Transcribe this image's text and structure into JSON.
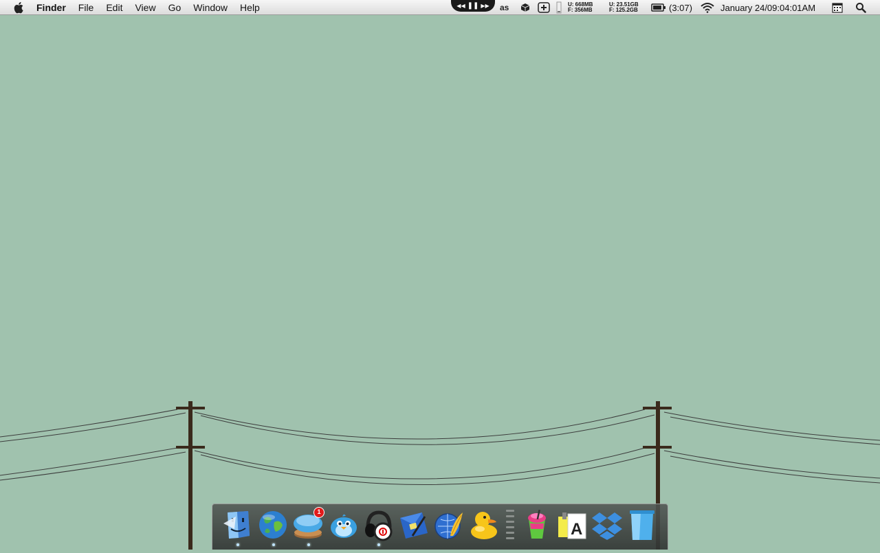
{
  "menubar": {
    "app_name": "Finder",
    "menus": [
      "File",
      "Edit",
      "View",
      "Go",
      "Window",
      "Help"
    ]
  },
  "status": {
    "memory_used": "U: 668MB",
    "memory_free": "F: 356MB",
    "disk_used": "U: 23.51GB",
    "disk_free": "F: 125.2GB",
    "battery_time": "(3:07)",
    "datetime": "January 24/09:04:01AM"
  },
  "dock": {
    "items": [
      {
        "name": "Finder",
        "running": true
      },
      {
        "name": "Globe browser",
        "running": true
      },
      {
        "name": "Message app",
        "running": true,
        "badge": "1"
      },
      {
        "name": "Twitter client",
        "running": false
      },
      {
        "name": "Beats headphones",
        "running": true
      },
      {
        "name": "Mail",
        "running": false
      },
      {
        "name": "Web globe app",
        "running": false
      },
      {
        "name": "Cyberduck",
        "running": false
      },
      {
        "name": "Slushie app",
        "running": false
      },
      {
        "name": "TextEdit",
        "running": false
      },
      {
        "name": "Dropbox",
        "running": false
      },
      {
        "name": "Trash",
        "running": false
      }
    ]
  },
  "colors": {
    "wallpaper": "#a0c2ae",
    "pole": "#3a2a1c",
    "wire": "#3b3b3b",
    "badge": "#e21b1b"
  }
}
